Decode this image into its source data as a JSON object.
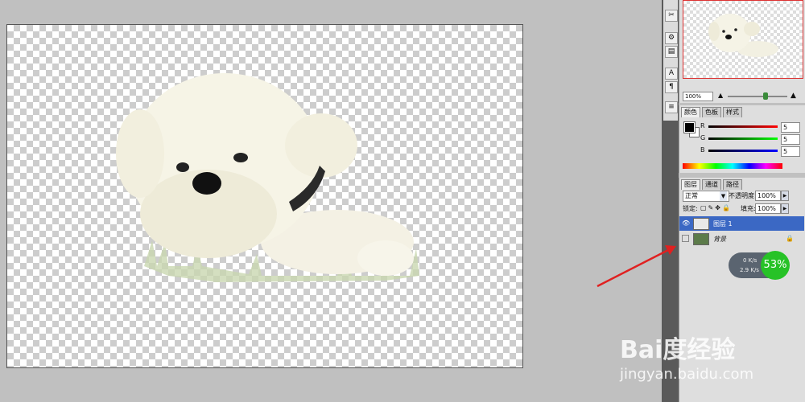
{
  "navigator": {
    "zoom": "100%"
  },
  "color_panel": {
    "tabs": [
      "颜色",
      "色板",
      "样式"
    ],
    "channels": [
      {
        "label": "R",
        "value": "5"
      },
      {
        "label": "G",
        "value": "5"
      },
      {
        "label": "B",
        "value": "5"
      }
    ]
  },
  "layers_panel": {
    "tabs": [
      "图层",
      "通道",
      "路径"
    ],
    "blend_mode": "正常",
    "opacity_label": "不透明度:",
    "opacity_value": "100%",
    "lock_label": "锁定:",
    "fill_label": "填充:",
    "fill_value": "100%",
    "layers": [
      {
        "name": "图层 1"
      },
      {
        "name": "背景"
      }
    ]
  },
  "network_widget": {
    "upload": "0 K/s",
    "download": "2.9 K/s",
    "percent": "53%"
  },
  "watermark": {
    "brand": "Bai度经验",
    "url": "jingyan.baidu.com"
  },
  "colors": {
    "selected_layer": "#3b68c4",
    "arrow": "#e02020",
    "badge_green": "#27c227"
  }
}
